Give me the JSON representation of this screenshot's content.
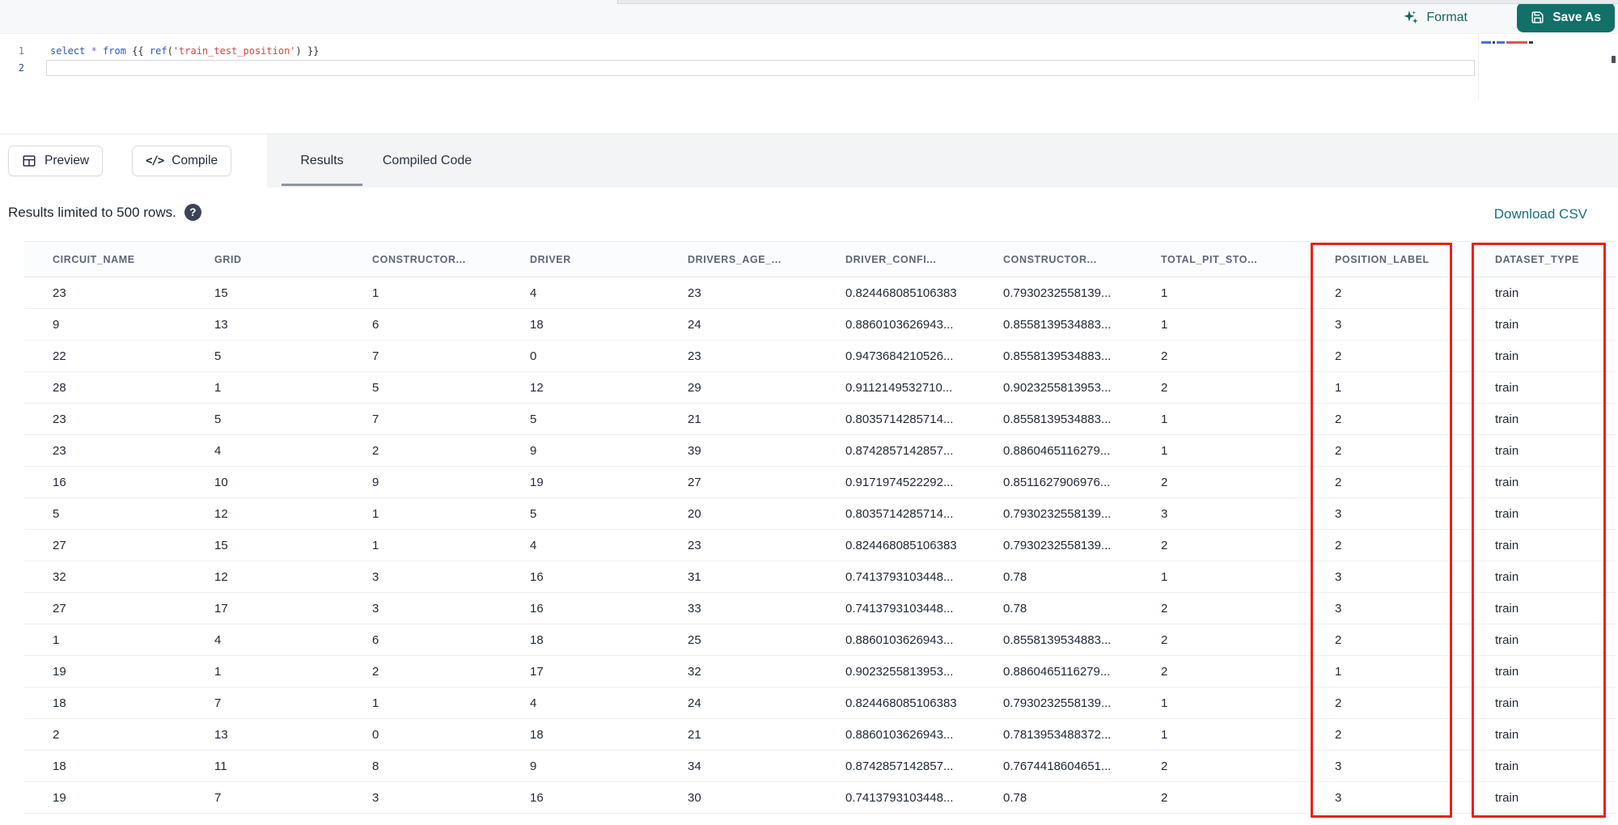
{
  "toolbar": {
    "format_label": "Format",
    "save_as_label": "Save As"
  },
  "editor": {
    "line_numbers": [
      "1",
      "2"
    ],
    "code_text": "select * from {{ ref('train_test_position') }}",
    "tokens": [
      {
        "text": "select",
        "type": "keyword"
      },
      {
        "text": " ",
        "type": "plain"
      },
      {
        "text": "*",
        "type": "operator"
      },
      {
        "text": " ",
        "type": "plain"
      },
      {
        "text": "from",
        "type": "keyword"
      },
      {
        "text": " ",
        "type": "plain"
      },
      {
        "text": "{{",
        "type": "plain"
      },
      {
        "text": " ",
        "type": "plain"
      },
      {
        "text": "ref",
        "type": "function"
      },
      {
        "text": "(",
        "type": "plain"
      },
      {
        "text": "'train_test_position'",
        "type": "string"
      },
      {
        "text": ")",
        "type": "plain"
      },
      {
        "text": " ",
        "type": "plain"
      },
      {
        "text": "}}",
        "type": "plain"
      }
    ]
  },
  "controls": {
    "preview_label": "Preview",
    "compile_label": "Compile",
    "compile_glyph": "</>"
  },
  "tabs": [
    {
      "label": "Results",
      "active": true
    },
    {
      "label": "Compiled Code",
      "active": false
    }
  ],
  "results_bar": {
    "info_text": "Results limited to 500 rows.",
    "help_glyph": "?",
    "download_label": "Download CSV"
  },
  "table": {
    "columns": [
      "CIRCUIT_NAME",
      "GRID",
      "CONSTRUCTOR...",
      "DRIVER",
      "DRIVERS_AGE_...",
      "DRIVER_CONFI...",
      "CONSTRUCTOR...",
      "TOTAL_PIT_STO...",
      "POSITION_LABEL",
      "DATASET_TYPE"
    ],
    "rows": [
      [
        "23",
        "15",
        "1",
        "4",
        "23",
        "0.824468085106383",
        "0.7930232558139...",
        "1",
        "2",
        "train"
      ],
      [
        "9",
        "13",
        "6",
        "18",
        "24",
        "0.8860103626943...",
        "0.8558139534883...",
        "1",
        "3",
        "train"
      ],
      [
        "22",
        "5",
        "7",
        "0",
        "23",
        "0.9473684210526...",
        "0.8558139534883...",
        "2",
        "2",
        "train"
      ],
      [
        "28",
        "1",
        "5",
        "12",
        "29",
        "0.9112149532710...",
        "0.9023255813953...",
        "2",
        "1",
        "train"
      ],
      [
        "23",
        "5",
        "7",
        "5",
        "21",
        "0.8035714285714...",
        "0.8558139534883...",
        "1",
        "2",
        "train"
      ],
      [
        "23",
        "4",
        "2",
        "9",
        "39",
        "0.8742857142857...",
        "0.8860465116279...",
        "1",
        "2",
        "train"
      ],
      [
        "16",
        "10",
        "9",
        "19",
        "27",
        "0.9171974522292...",
        "0.8511627906976...",
        "2",
        "2",
        "train"
      ],
      [
        "5",
        "12",
        "1",
        "5",
        "20",
        "0.8035714285714...",
        "0.7930232558139...",
        "3",
        "3",
        "train"
      ],
      [
        "27",
        "15",
        "1",
        "4",
        "23",
        "0.824468085106383",
        "0.7930232558139...",
        "2",
        "2",
        "train"
      ],
      [
        "32",
        "12",
        "3",
        "16",
        "31",
        "0.7413793103448...",
        "0.78",
        "1",
        "3",
        "train"
      ],
      [
        "27",
        "17",
        "3",
        "16",
        "33",
        "0.7413793103448...",
        "0.78",
        "2",
        "3",
        "train"
      ],
      [
        "1",
        "4",
        "6",
        "18",
        "25",
        "0.8860103626943...",
        "0.8558139534883...",
        "2",
        "2",
        "train"
      ],
      [
        "19",
        "1",
        "2",
        "17",
        "32",
        "0.9023255813953...",
        "0.8860465116279...",
        "2",
        "1",
        "train"
      ],
      [
        "18",
        "7",
        "1",
        "4",
        "24",
        "0.824468085106383",
        "0.7930232558139...",
        "1",
        "2",
        "train"
      ],
      [
        "2",
        "13",
        "0",
        "18",
        "21",
        "0.8860103626943...",
        "0.7813953488372...",
        "1",
        "2",
        "train"
      ],
      [
        "18",
        "11",
        "8",
        "9",
        "34",
        "0.8742857142857...",
        "0.7674418604651...",
        "2",
        "3",
        "train"
      ],
      [
        "19",
        "7",
        "3",
        "16",
        "30",
        "0.7413793103448...",
        "0.78",
        "2",
        "3",
        "train"
      ]
    ]
  },
  "annotations": {
    "highlight_color": "#ee1f16",
    "highlighted_columns": [
      "POSITION_LABEL",
      "DATASET_TYPE"
    ]
  },
  "icons": {
    "format": "sparkles-icon",
    "save_as": "floppy-disk-icon",
    "preview": "table-grid-icon",
    "compile": "code-brackets-icon",
    "help": "question-mark-icon"
  },
  "colors": {
    "accent_teal": "#127069",
    "link_teal": "#16707c",
    "keyword_blue": "#2e55cf",
    "string_red": "#d8453e",
    "annotation_red": "#ee1f16"
  }
}
